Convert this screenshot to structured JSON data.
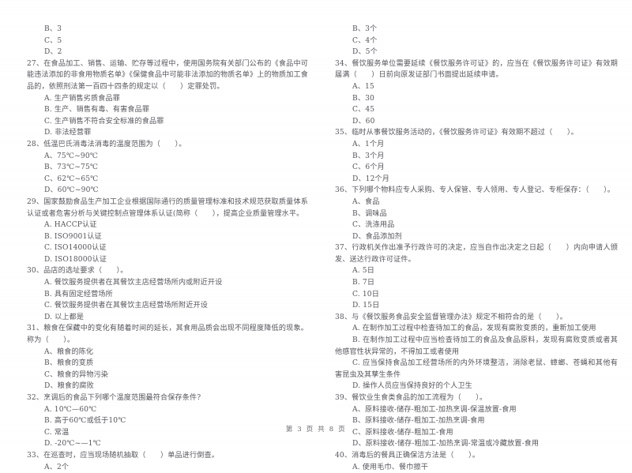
{
  "document": {
    "footer": "第 3 页  共 8 页",
    "page_number": "3",
    "total_pages": "8"
  },
  "left_column": {
    "blocks": [
      {
        "type": "option",
        "text": "B、3"
      },
      {
        "type": "option",
        "text": "C、5"
      },
      {
        "type": "option",
        "text": "D、2"
      },
      {
        "type": "stem",
        "text": "27、在食品加工、销售、运输、贮存等过程中，使用国务院有关部门公布的《食品中可能违法添加的非食用物质名单》《保健食品中可能非法添加的物质名单》上的物质加工食品的，依照刑法第一百四十四条的规定以（　　）定罪处罚。"
      },
      {
        "type": "option",
        "text": "A. 生产销售劣质食品罪"
      },
      {
        "type": "option",
        "text": "B. 生产、销售有毒、有害食品罪"
      },
      {
        "type": "option",
        "text": "C. 生产销售不符合安全标准的食品罪"
      },
      {
        "type": "option",
        "text": "D. 非法经营罪"
      },
      {
        "type": "stem",
        "text": "28、低温巴氏消毒法消毒的温度范围为（　　）。"
      },
      {
        "type": "option",
        "text": "A、75℃~90℃"
      },
      {
        "type": "option",
        "text": "B、73℃~75℃"
      },
      {
        "type": "option",
        "text": "C、62℃~65℃"
      },
      {
        "type": "option",
        "text": "D、60℃~90℃"
      },
      {
        "type": "stem",
        "text": "29、国家鼓励食品生产加工企业根据国际通行的质量管理标准和技术规范获取质量体系认证或者危害分析与关键控制点管理体系认证(简称（　　），提高企业质量管理水平。"
      },
      {
        "type": "option",
        "text": "A. HACCP认证"
      },
      {
        "type": "option",
        "text": "B. ISO9001认证"
      },
      {
        "type": "option",
        "text": "C. ISO14000认证"
      },
      {
        "type": "option",
        "text": "D. ISO18000认证"
      },
      {
        "type": "stem",
        "text": "30、品店的选址要求（　　）。"
      },
      {
        "type": "option",
        "text": "A. 餐饮服务提供者在其餐饮主店经营场所内或附近开设"
      },
      {
        "type": "option",
        "text": "B. 具有固定经营场所"
      },
      {
        "type": "option",
        "text": "C. 餐饮服务提供者在其餐饮主店经营场所附近开设"
      },
      {
        "type": "option",
        "text": "D. 以上都是"
      },
      {
        "type": "stem",
        "text": "31、粮食在保藏中的变化有随着时间的延长，其食用品质会出现不同程度降低的现象。称为（　　）。"
      },
      {
        "type": "option",
        "text": "A、粮食的陈化"
      },
      {
        "type": "option",
        "text": "B、粮食的变质"
      },
      {
        "type": "option",
        "text": "C、粮食的异物污染"
      },
      {
        "type": "option",
        "text": "D、粮食的腐败"
      },
      {
        "type": "stem",
        "text": "32、烹调后的食品下列哪个温度范围最符合保存条件?"
      },
      {
        "type": "option",
        "text": "A. 10℃—60℃"
      },
      {
        "type": "option",
        "text": "B. 高于60℃或低于10℃"
      },
      {
        "type": "option",
        "text": "C. 常温"
      },
      {
        "type": "option",
        "text": "D. -20℃~—1℃"
      },
      {
        "type": "stem",
        "text": "33、在巡查时，应当现场随机抽取（　　）单品进行倒查。"
      },
      {
        "type": "option",
        "text": "A、2个"
      }
    ]
  },
  "right_column": {
    "blocks": [
      {
        "type": "option",
        "text": "B、3个"
      },
      {
        "type": "option",
        "text": "C、4个"
      },
      {
        "type": "option",
        "text": "D、5个"
      },
      {
        "type": "stem",
        "text": "34、餐饮服务单位需要延续《餐饮服务许可证》的，应当在《餐饮服务许可证》有效期届满（　　）日前向原发证部门书面提出延续申请。"
      },
      {
        "type": "option",
        "text": "A、15"
      },
      {
        "type": "option",
        "text": "B、30"
      },
      {
        "type": "option",
        "text": "C、45"
      },
      {
        "type": "option",
        "text": "D、60"
      },
      {
        "type": "stem",
        "text": "35、临时从事餐饮服务活动的，《餐饮服务许可证》有效期不超过（　　）。"
      },
      {
        "type": "option",
        "text": "A、1个月"
      },
      {
        "type": "option",
        "text": "B、3个月"
      },
      {
        "type": "option",
        "text": "C、6个月"
      },
      {
        "type": "option",
        "text": "D、12个月"
      },
      {
        "type": "stem",
        "text": "36、下列哪个物料应专人采购、专人保管、专人领用、专人登记、专柜保存：（　　）。"
      },
      {
        "type": "option",
        "text": "A、食品"
      },
      {
        "type": "option",
        "text": "B、调味品"
      },
      {
        "type": "option",
        "text": "C、洗涤用品"
      },
      {
        "type": "option",
        "text": "D、食品添加剂"
      },
      {
        "type": "stem",
        "text": "37、行政机关作出准予行政许可的决定，应当自作出决定之日起（　　）内向申请人颁发、送达行政许可证件。"
      },
      {
        "type": "option",
        "text": "A. 5日"
      },
      {
        "type": "option",
        "text": "B. 7日"
      },
      {
        "type": "option",
        "text": "C. 10日"
      },
      {
        "type": "option",
        "text": "D. 15日"
      },
      {
        "type": "stem",
        "text": "38、与《餐饮服务食品安全监督管理办法》规定不相符合的是（　　）。"
      },
      {
        "type": "option",
        "text": "A. 在制作加工过程中检查待加工的食品，发现有腐败变质的，重新加工使用"
      },
      {
        "type": "option_hang",
        "text": "B. 在制作加工过程中应当检查待加工的食品及食品原料，发现有腐败变质或者其他感官性状异常的，不得加工或者使用"
      },
      {
        "type": "option_hang",
        "text": "C. 应当保持食品加工经营场所的内外环境整洁，消除老鼠、蟑螂、苍蝇和其他有害昆虫及其孳生条件"
      },
      {
        "type": "option",
        "text": "D. 操作人员应当保持良好的个人卫生"
      },
      {
        "type": "stem",
        "text": "39、餐饮业生食类食品的加工流程为（　　）。"
      },
      {
        "type": "option",
        "text": "A、原料接收-储存-粗加工-加热烹调-保温放置-食用"
      },
      {
        "type": "option",
        "text": "B、原料接收-储存-粗加工-加热烹调-食用"
      },
      {
        "type": "option",
        "text": "C、原料接收-储存-粗加工-食用"
      },
      {
        "type": "option",
        "text": "D、原料接收-储存-粗加工-加热烹调-常温或冷藏放置-食用"
      },
      {
        "type": "stem",
        "text": "40、消毒后的餐具正确保洁方法是（　　）。"
      },
      {
        "type": "option",
        "text": "A. 使用毛巾、餐巾擦干"
      }
    ]
  }
}
